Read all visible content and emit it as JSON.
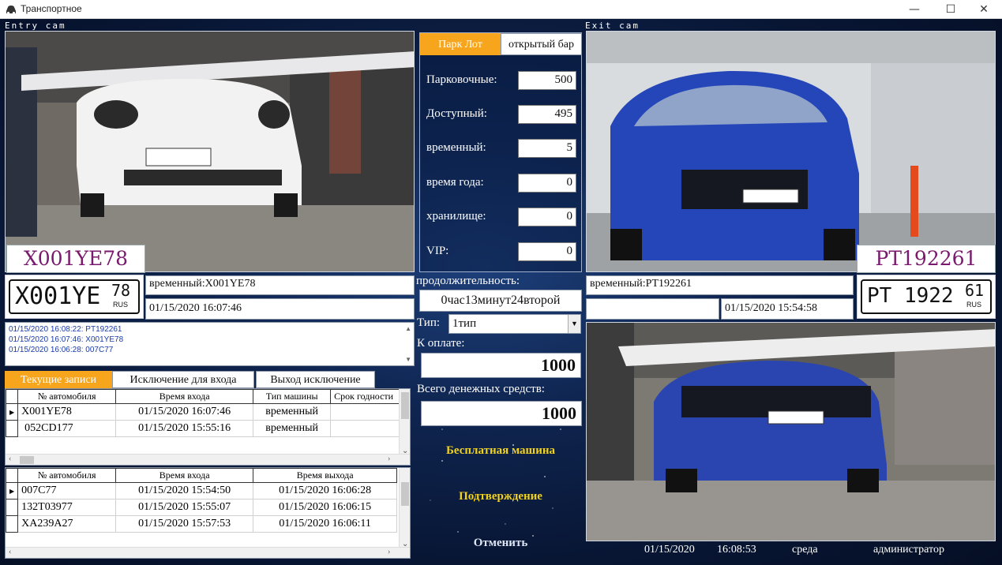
{
  "window": {
    "title": "Транспортное",
    "minimize": "—",
    "maximize": "☐",
    "close": "✕"
  },
  "entry": {
    "cam_label": "Entry cam",
    "plate": "X001YE78",
    "plate_img_text": "X001YE",
    "plate_img_region": "78",
    "plate_img_country": "RUS",
    "record_line": "временный:X001YE78",
    "time": "01/15/2020 16:07:46"
  },
  "exit": {
    "cam_label": "Exit cam",
    "plate": "PT192261",
    "plate_img_text": "PT 1922",
    "plate_img_region": "61",
    "plate_img_country": "RUS",
    "record_line": "временный:PT192261",
    "time_left": "",
    "time": "01/15/2020 15:54:58"
  },
  "log": [
    "01/15/2020 16:08:22: PT192261",
    "01/15/2020 16:07:46: X001YE78",
    "01/15/2020 16:06:28: 007C77"
  ],
  "tabs": [
    "Текущие записи",
    "Исключение для входа",
    "Выход исключение"
  ],
  "current_table": {
    "headers": [
      "№ автомобиля",
      "Время входа",
      "Тип машины",
      "Срок годности"
    ],
    "rows": [
      [
        "X001YE78",
        "01/15/2020 16:07:46",
        "временный",
        ""
      ],
      [
        "052CD177",
        "01/15/2020 15:55:16",
        "временный",
        ""
      ]
    ]
  },
  "exit_table": {
    "headers": [
      "№ автомобиля",
      "Время входа",
      "Время выхода"
    ],
    "rows": [
      [
        "007C77",
        "01/15/2020 15:54:50",
        "01/15/2020 16:06:28"
      ],
      [
        "132T03977",
        "01/15/2020 15:55:07",
        "01/15/2020 16:06:15"
      ],
      [
        "XA239A27",
        "01/15/2020 15:57:53",
        "01/15/2020 16:06:11"
      ]
    ]
  },
  "lot": {
    "tab_park": "Парк Лот",
    "tab_open": "открытый бар",
    "rows": [
      {
        "label": "Парковочные:",
        "value": "500"
      },
      {
        "label": "Доступный:",
        "value": "495"
      },
      {
        "label": "временный:",
        "value": "5"
      },
      {
        "label": "время года:",
        "value": "0"
      },
      {
        "label": "хранилище:",
        "value": "0"
      },
      {
        "label": "VIP:",
        "value": "0"
      }
    ]
  },
  "billing": {
    "duration_label": "продолжительность:",
    "duration_value": "0час13минут24второй",
    "type_label": "Тип:",
    "type_value": "1тип",
    "pay_label": "К оплате:",
    "pay_value": "1000",
    "total_label": "Всего денежных средств:",
    "total_value": "1000",
    "free_car": "Бесплатная машина",
    "confirm": "Подтверждение",
    "cancel": "Отменить"
  },
  "statusbar": {
    "date": "01/15/2020",
    "time": "16:08:53",
    "weekday": "среда",
    "user": "администратор"
  },
  "colors": {
    "accent": "#f7a51c",
    "plate_text": "#7a1a6e",
    "button_text": "#f2d21b",
    "log_text": "#1a3aa8"
  }
}
